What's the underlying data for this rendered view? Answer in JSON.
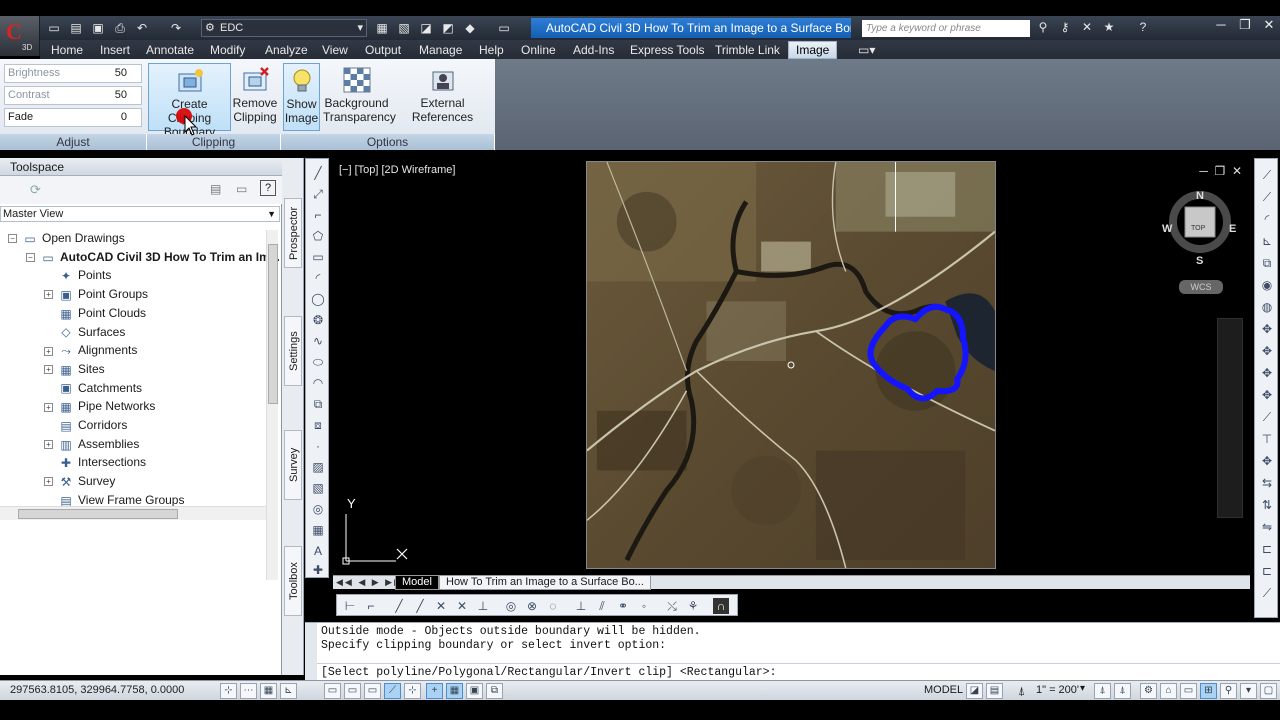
{
  "app": {
    "logo_letter": "C",
    "logo_sub": "3D",
    "workspace": "EDC",
    "window_title": "AutoCAD Civil 3D  How To Trim an Image to a Surface Bord...",
    "search_placeholder": "Type a keyword or phrase"
  },
  "ribbon": {
    "tabs": [
      "Home",
      "Insert",
      "Annotate",
      "Modify",
      "Analyze",
      "View",
      "Output",
      "Manage",
      "Help",
      "Online",
      "Add-Ins",
      "Express Tools",
      "Trimble Link",
      "Image"
    ],
    "active_tab": "Image",
    "adjust": {
      "title": "Adjust",
      "brightness_label": "Brightness",
      "brightness_value": "50",
      "contrast_label": "Contrast",
      "contrast_value": "50",
      "fade_label": "Fade",
      "fade_value": "0"
    },
    "clipping": {
      "title": "Clipping",
      "create_line1": "Create Clipping",
      "create_line2": "Boundary",
      "remove_line1": "Remove",
      "remove_line2": "Clipping"
    },
    "options": {
      "title": "Options",
      "show_line1": "Show",
      "show_line2": "Image",
      "bg_line1": "Background",
      "bg_line2": "Transparency",
      "xref": "External References"
    }
  },
  "toolspace": {
    "title": "Toolspace",
    "view_select": "Master View",
    "tree": [
      {
        "label": "Open Drawings",
        "level": 0,
        "exp": "−"
      },
      {
        "label": "AutoCAD Civil 3D How To Trim an Im...",
        "level": 1,
        "exp": "−",
        "bold": true
      },
      {
        "label": "Points",
        "level": 2,
        "exp": ""
      },
      {
        "label": "Point Groups",
        "level": 2,
        "exp": "+"
      },
      {
        "label": "Point Clouds",
        "level": 2,
        "exp": ""
      },
      {
        "label": "Surfaces",
        "level": 2,
        "exp": ""
      },
      {
        "label": "Alignments",
        "level": 2,
        "exp": "+"
      },
      {
        "label": "Sites",
        "level": 2,
        "exp": "+"
      },
      {
        "label": "Catchments",
        "level": 2,
        "exp": ""
      },
      {
        "label": "Pipe Networks",
        "level": 2,
        "exp": "+"
      },
      {
        "label": "Corridors",
        "level": 2,
        "exp": ""
      },
      {
        "label": "Assemblies",
        "level": 2,
        "exp": "+"
      },
      {
        "label": "Intersections",
        "level": 2,
        "exp": ""
      },
      {
        "label": "Survey",
        "level": 2,
        "exp": "+"
      },
      {
        "label": "View Frame Groups",
        "level": 2,
        "exp": ""
      }
    ],
    "side_tabs": [
      "Prospector",
      "Settings",
      "Survey",
      "Toolbox"
    ]
  },
  "viewport": {
    "label": "[−] [Top] [2D Wireframe]",
    "compass": {
      "n": "N",
      "s": "S",
      "e": "E",
      "w": "W",
      "top": "TOP",
      "wcs": "WCS"
    },
    "ucs_y": "Y"
  },
  "layout_tabs": [
    "Model",
    "How To Trim an Image to a Surface Bo..."
  ],
  "command": {
    "line1": "Outside mode - Objects outside boundary will be hidden.",
    "line2": "Specify clipping boundary or select invert option:",
    "prompt": "[Select polyline/Polygonal/Rectangular/Invert clip] <Rectangular>:"
  },
  "status": {
    "coords": "297563.8105, 329964.7758, 0.0000",
    "model": "MODEL",
    "scale": "1\" = 200'"
  }
}
